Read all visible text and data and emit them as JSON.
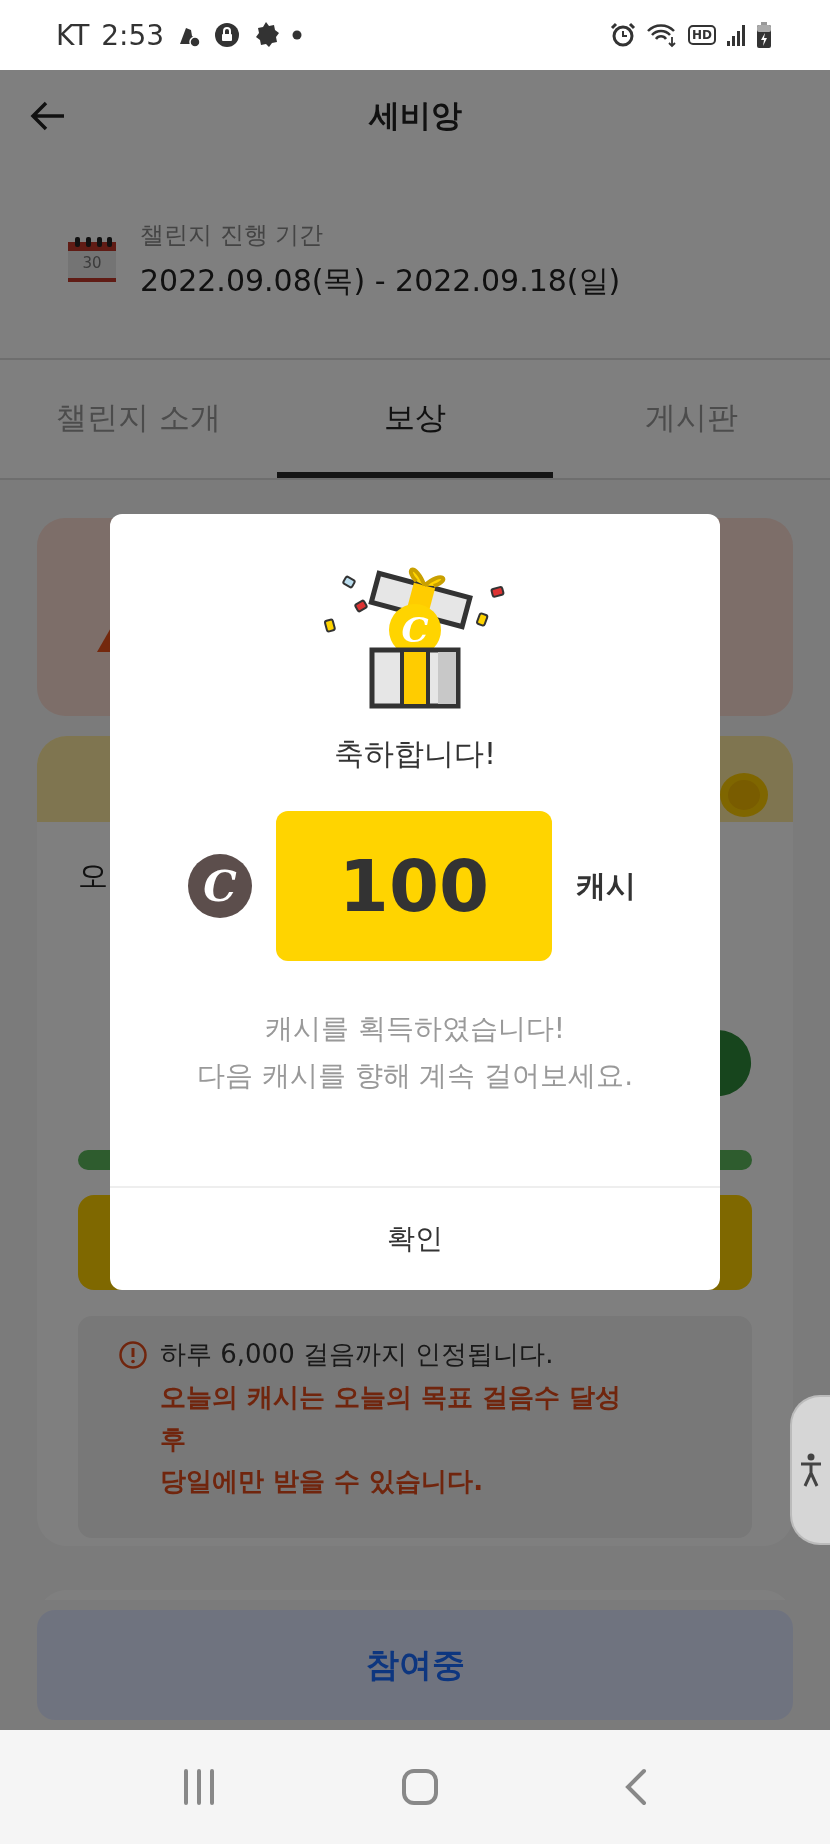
{
  "status_bar": {
    "carrier": "KT",
    "time": "2:53",
    "hd_label": "HD"
  },
  "header": {
    "title": "세비앙"
  },
  "period": {
    "calendar_day": "30",
    "label": "챌린지 진행 기간",
    "dates": "2022.09.08(목) - 2022.09.18(일)"
  },
  "tabs": [
    {
      "label": "챌린지 소개",
      "selected": false
    },
    {
      "label": "보상",
      "selected": true
    },
    {
      "label": "게시판",
      "selected": false
    }
  ],
  "today_card": {
    "title_partial": "오"
  },
  "notice": {
    "info": "하루 6,000 걸음까지 인정됩니다.",
    "warning": "오늘의 캐시는 오늘의 목표 걸음수 달성\n후\n당일에만 받을 수 있습니다."
  },
  "join_button": {
    "label": "참여중"
  },
  "dialog": {
    "gift_coin_symbol": "C",
    "heading": "축하합니다!",
    "coin_symbol": "C",
    "amount": "100",
    "unit": "캐시",
    "message": "캐시를 획득하였습니다!\n다음 캐시를 향해 계속 걸어보세요.",
    "confirm": "확인"
  }
}
